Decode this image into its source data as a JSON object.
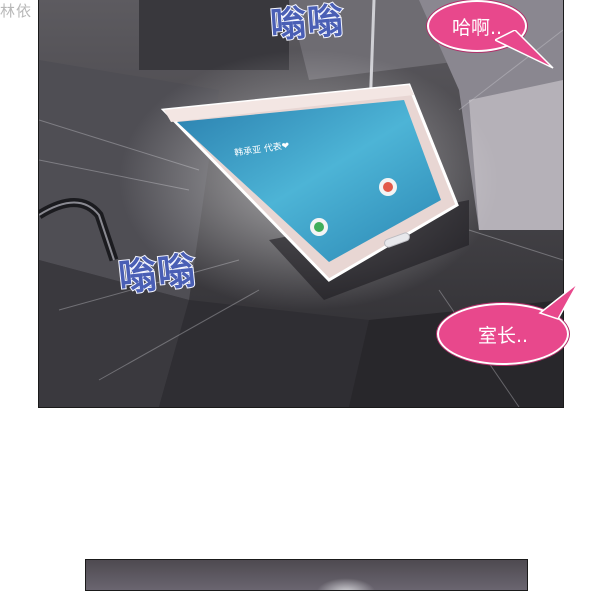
{
  "watermark": "林依",
  "sfx": {
    "top": "嗡嗡",
    "left": "嗡嗡"
  },
  "phone": {
    "caller": "韩承亚 代表❤"
  },
  "bubbles": {
    "top": "哈啊..",
    "bottom": "室长.."
  },
  "colors": {
    "bubble": "#e8488c",
    "sfx": "#4a5fb5",
    "screen": "#3a9bc4"
  }
}
